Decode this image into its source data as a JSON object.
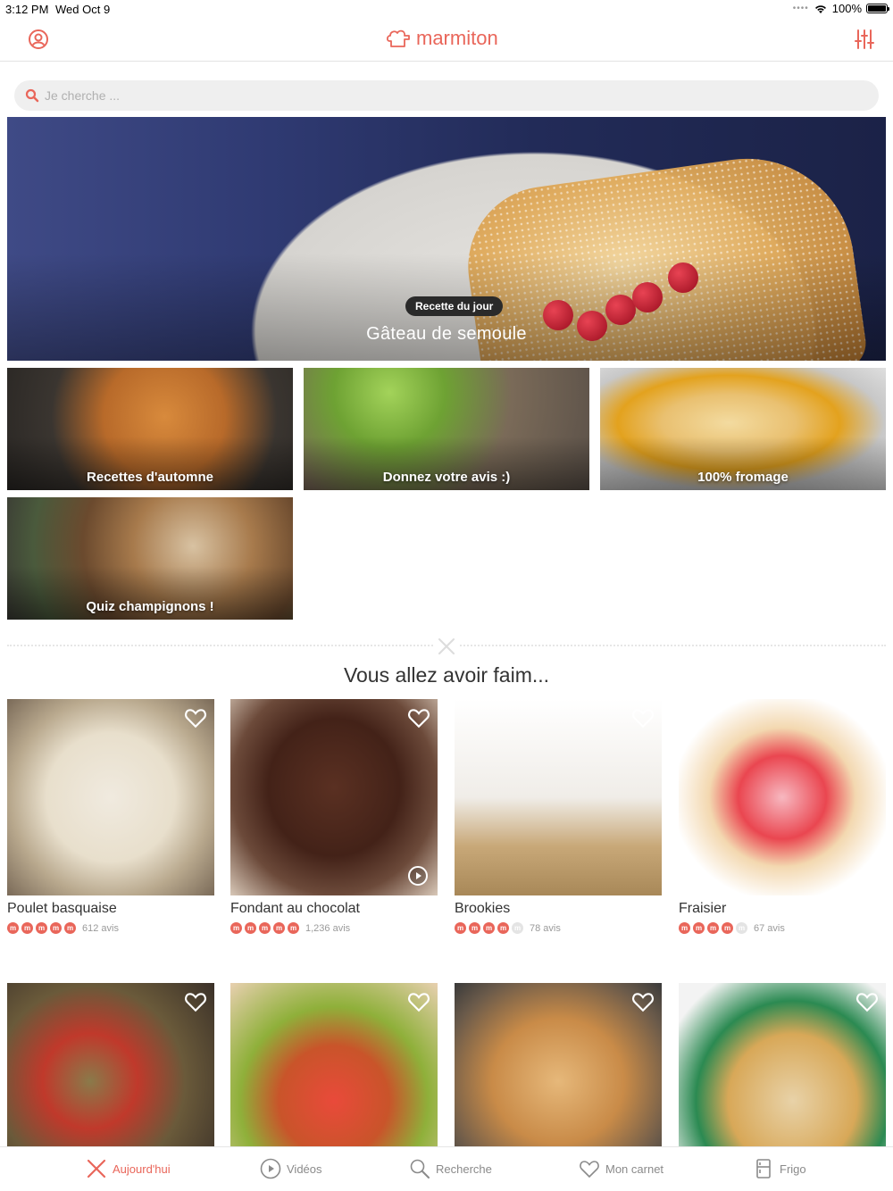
{
  "status_bar": {
    "time": "3:12 PM",
    "date": "Wed Oct 9",
    "battery": "100%"
  },
  "header": {
    "logo_text": "marmiton",
    "brand_color": "#e9665a"
  },
  "search": {
    "placeholder": "Je cherche ..."
  },
  "hero": {
    "tag": "Recette du jour",
    "title": "Gâteau de semoule"
  },
  "categories": [
    {
      "label": "Recettes d'automne"
    },
    {
      "label": "Donnez votre avis :)"
    },
    {
      "label": "100% fromage"
    },
    {
      "label": "Quiz champignons !"
    }
  ],
  "section": {
    "title": "Vous allez avoir faim..."
  },
  "recipes": [
    {
      "name": "Poulet basquaise",
      "rating": 5,
      "reviews": "612 avis"
    },
    {
      "name": "Fondant au chocolat",
      "rating": 5,
      "reviews": "1,236 avis"
    },
    {
      "name": "Brookies",
      "rating": 4,
      "reviews": "78 avis"
    },
    {
      "name": "Fraisier",
      "rating": 4,
      "reviews": "67 avis"
    }
  ],
  "tabs": [
    {
      "label": "Aujourd'hui",
      "icon": "utensils-icon",
      "active": true
    },
    {
      "label": "Vidéos",
      "icon": "play-circle-icon"
    },
    {
      "label": "Recherche",
      "icon": "search-icon"
    },
    {
      "label": "Mon carnet",
      "icon": "heart-icon"
    },
    {
      "label": "Frigo",
      "icon": "fridge-icon"
    }
  ]
}
